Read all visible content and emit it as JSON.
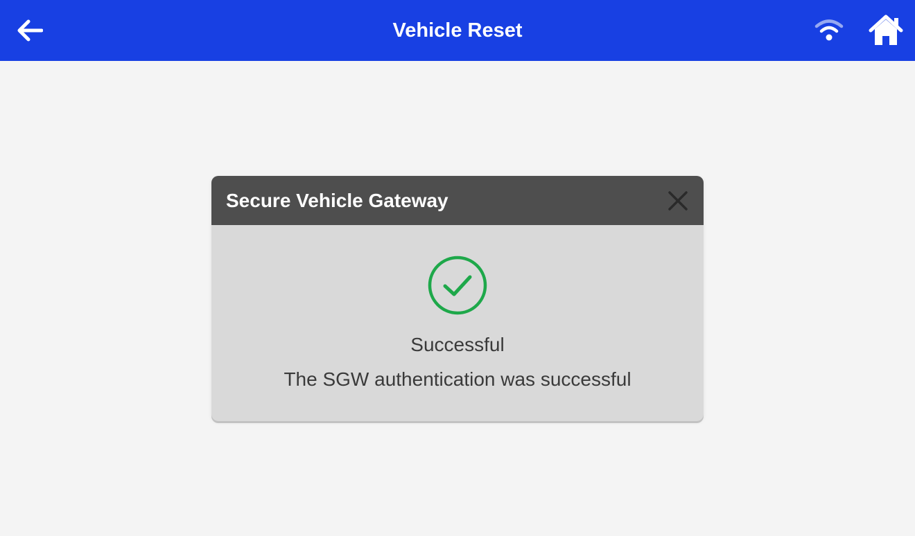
{
  "header": {
    "title": "Vehicle Reset",
    "back_icon": "arrow-left-icon",
    "wifi_icon": "wifi-icon",
    "home_icon": "home-icon",
    "background_color": "#1840e3"
  },
  "dialog": {
    "title": "Secure Vehicle Gateway",
    "close_icon": "close-icon",
    "status_icon": "check-circle-icon",
    "status_color": "#1ea84a",
    "status": "Successful",
    "message": "The SGW authentication was successful"
  }
}
